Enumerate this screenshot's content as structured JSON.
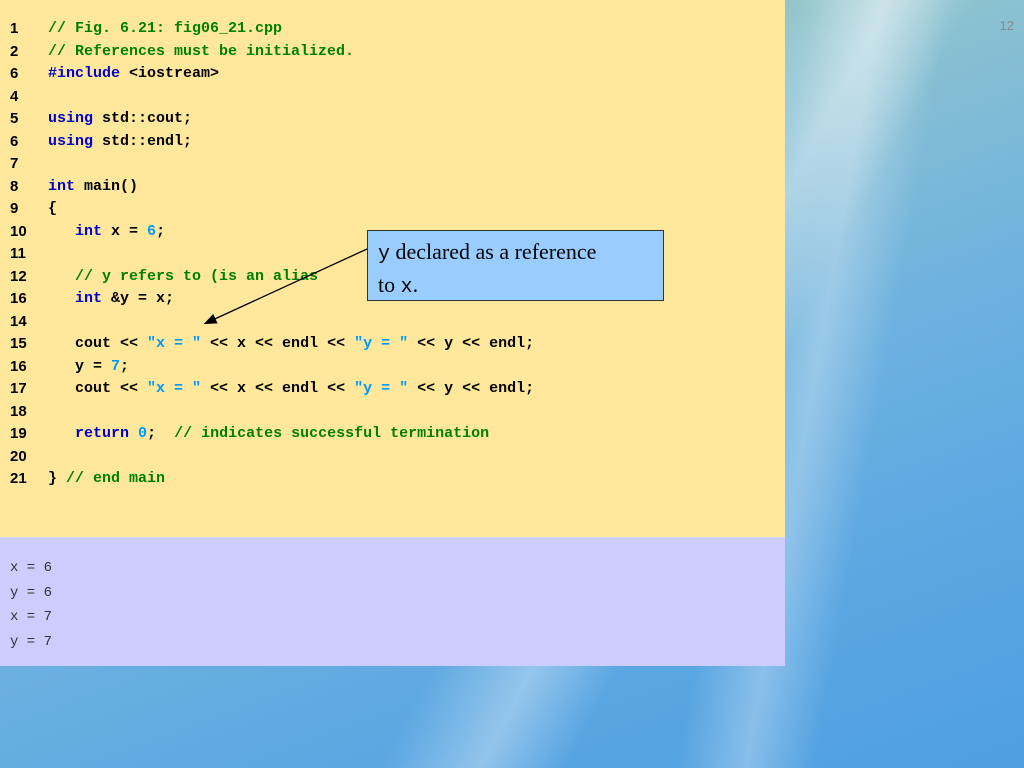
{
  "slide": {
    "number": "12"
  },
  "code_lines": [
    {
      "num": "1",
      "segments": [
        {
          "t": "cm",
          "text": "// Fig. 6.21: fig06_21.cpp"
        }
      ]
    },
    {
      "num": "2",
      "segments": [
        {
          "t": "cm",
          "text": "// References must be initialized."
        }
      ]
    },
    {
      "num": "6",
      "segments": [
        {
          "t": "kw",
          "text": "#include"
        },
        {
          "t": "tx",
          "text": " <iostream>"
        }
      ]
    },
    {
      "num": "4",
      "segments": []
    },
    {
      "num": "5",
      "segments": [
        {
          "t": "kw",
          "text": "using"
        },
        {
          "t": "tx",
          "text": " std::cout;"
        }
      ]
    },
    {
      "num": "6",
      "segments": [
        {
          "t": "kw",
          "text": "using"
        },
        {
          "t": "tx",
          "text": " std::endl;"
        }
      ]
    },
    {
      "num": "7",
      "segments": []
    },
    {
      "num": "8",
      "segments": [
        {
          "t": "kw",
          "text": "int"
        },
        {
          "t": "tx",
          "text": " main()"
        }
      ]
    },
    {
      "num": "9",
      "segments": [
        {
          "t": "tx",
          "text": "{"
        }
      ]
    },
    {
      "num": "10",
      "segments": [
        {
          "t": "tx",
          "text": "   "
        },
        {
          "t": "kw",
          "text": "int"
        },
        {
          "t": "tx",
          "text": " x = "
        },
        {
          "t": "nm",
          "text": "6"
        },
        {
          "t": "tx",
          "text": ";"
        }
      ]
    },
    {
      "num": "11",
      "segments": []
    },
    {
      "num": "12",
      "segments": [
        {
          "t": "tx",
          "text": "   "
        },
        {
          "t": "cm",
          "text": "// y refers to (is an alias"
        }
      ]
    },
    {
      "num": "16",
      "segments": [
        {
          "t": "tx",
          "text": "   "
        },
        {
          "t": "kw",
          "text": "int"
        },
        {
          "t": "tx",
          "text": " &y = x;"
        }
      ]
    },
    {
      "num": "14",
      "segments": []
    },
    {
      "num": "15",
      "segments": [
        {
          "t": "tx",
          "text": "   cout << "
        },
        {
          "t": "st",
          "text": "\"x = \""
        },
        {
          "t": "tx",
          "text": " << x << endl << "
        },
        {
          "t": "st",
          "text": "\"y = \""
        },
        {
          "t": "tx",
          "text": " << y << endl;"
        }
      ]
    },
    {
      "num": "16",
      "segments": [
        {
          "t": "tx",
          "text": "   y = "
        },
        {
          "t": "nm",
          "text": "7"
        },
        {
          "t": "tx",
          "text": ";"
        }
      ]
    },
    {
      "num": "17",
      "segments": [
        {
          "t": "tx",
          "text": "   cout << "
        },
        {
          "t": "st",
          "text": "\"x = \""
        },
        {
          "t": "tx",
          "text": " << x << endl << "
        },
        {
          "t": "st",
          "text": "\"y = \""
        },
        {
          "t": "tx",
          "text": " << y << endl;"
        }
      ]
    },
    {
      "num": "18",
      "segments": []
    },
    {
      "num": "19",
      "segments": [
        {
          "t": "tx",
          "text": "   "
        },
        {
          "t": "kw",
          "text": "return"
        },
        {
          "t": "tx",
          "text": " "
        },
        {
          "t": "nm",
          "text": "0"
        },
        {
          "t": "tx",
          "text": ";  "
        },
        {
          "t": "cm",
          "text": "// indicates successful termination"
        }
      ]
    },
    {
      "num": "20",
      "segments": []
    },
    {
      "num": "21",
      "segments": [
        {
          "t": "tx",
          "text": "} "
        },
        {
          "t": "cm",
          "text": "// end main"
        }
      ]
    }
  ],
  "output_lines": [
    "x = 6",
    "y = 6",
    "x = 7",
    "y = 7"
  ],
  "callout": {
    "var": "y",
    "text1": " declared as a reference",
    "text2": "to ",
    "var2": "x",
    "text3": "."
  },
  "colors": {
    "code_bg": "#ffe79b",
    "output_bg": "#ccccff",
    "comment": "#008000",
    "keyword": "#0000cc",
    "literal": "#0099ff",
    "callout_bg": "#99ccff"
  }
}
